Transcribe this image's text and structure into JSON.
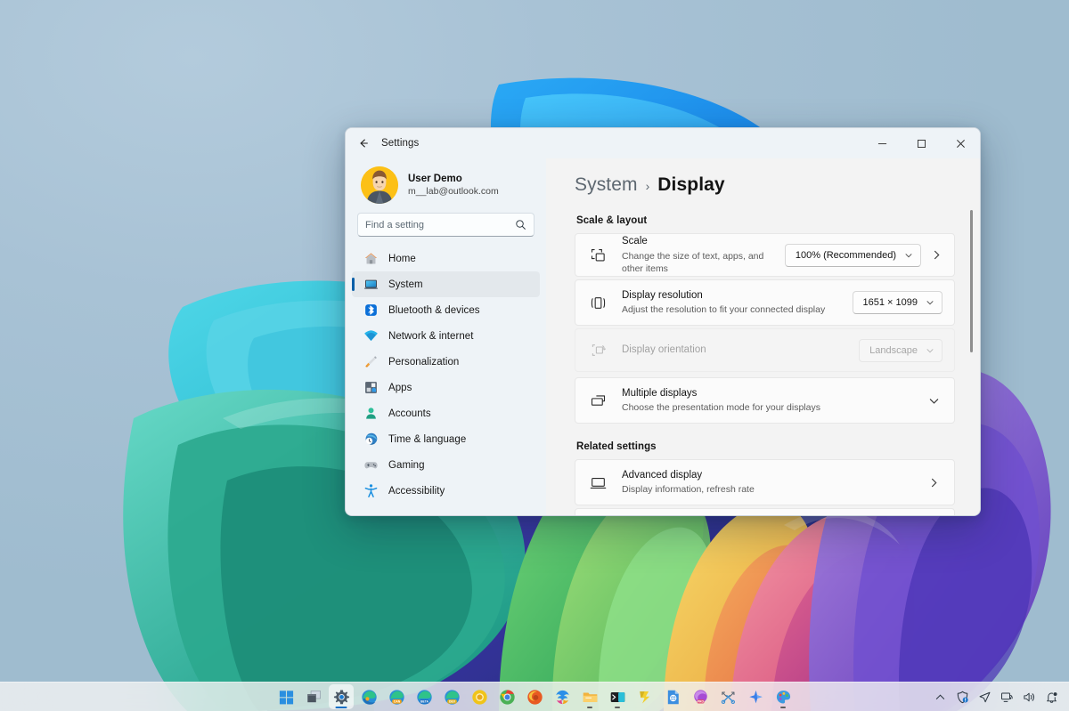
{
  "window": {
    "title": "Settings",
    "back_icon": "back-arrow-icon",
    "controls": {
      "minimize": "minimize-icon",
      "maximize": "maximize-icon",
      "close": "close-icon"
    }
  },
  "profile": {
    "name": "User Demo",
    "email": "m__lab@outlook.com",
    "avatar_icon": "user-avatar",
    "avatar_bg": "#fcc016"
  },
  "search": {
    "placeholder": "Find a setting",
    "value": "",
    "icon": "search-icon"
  },
  "sidebar": {
    "items": [
      {
        "label": "Home",
        "icon": "home-icon",
        "selected": false
      },
      {
        "label": "System",
        "icon": "system-icon",
        "selected": true
      },
      {
        "label": "Bluetooth & devices",
        "icon": "bluetooth-icon",
        "selected": false
      },
      {
        "label": "Network & internet",
        "icon": "network-icon",
        "selected": false
      },
      {
        "label": "Personalization",
        "icon": "brush-icon",
        "selected": false
      },
      {
        "label": "Apps",
        "icon": "apps-icon",
        "selected": false
      },
      {
        "label": "Accounts",
        "icon": "accounts-icon",
        "selected": false
      },
      {
        "label": "Time & language",
        "icon": "clock-globe-icon",
        "selected": false
      },
      {
        "label": "Gaming",
        "icon": "gamepad-icon",
        "selected": false
      },
      {
        "label": "Accessibility",
        "icon": "accessibility-icon",
        "selected": false
      }
    ]
  },
  "breadcrumb": {
    "parent": "System",
    "separator": "›",
    "current": "Display"
  },
  "main": {
    "section1_title": "Scale & layout",
    "section2_title": "Related settings",
    "cards": [
      {
        "title": "Scale",
        "subtitle": "Change the size of text, apps, and other items",
        "icon": "scale-icon",
        "combo_value": "100% (Recommended)",
        "has_chevron_right": true,
        "disabled": false
      },
      {
        "title": "Display resolution",
        "subtitle": "Adjust the resolution to fit your connected display",
        "icon": "resolution-icon",
        "combo_value": "1651 × 1099",
        "has_chevron_right": false,
        "disabled": false
      },
      {
        "title": "Display orientation",
        "subtitle": "",
        "icon": "orientation-icon",
        "combo_value": "Landscape",
        "has_chevron_right": false,
        "disabled": true
      },
      {
        "title": "Multiple displays",
        "subtitle": "Choose the presentation mode for your displays",
        "icon": "multiple-displays-icon",
        "combo_value": "",
        "has_chevron_down": true,
        "disabled": false
      }
    ],
    "related": [
      {
        "title": "Advanced display",
        "subtitle": "Display information, refresh rate",
        "icon": "advanced-display-icon",
        "has_chevron_right": true
      }
    ]
  },
  "taskbar": {
    "apps": [
      {
        "name": "start-button",
        "running": false,
        "active": false
      },
      {
        "name": "task-view-button",
        "running": false,
        "active": false
      },
      {
        "name": "settings-app",
        "running": true,
        "active": true
      },
      {
        "name": "edge-browser",
        "running": false,
        "active": false
      },
      {
        "name": "edge-canary-browser",
        "running": false,
        "active": false
      },
      {
        "name": "edge-beta-browser",
        "running": false,
        "active": false
      },
      {
        "name": "edge-dev-browser",
        "running": false,
        "active": false
      },
      {
        "name": "chrome-canary-browser",
        "running": false,
        "active": false
      },
      {
        "name": "chrome-browser",
        "running": false,
        "active": false
      },
      {
        "name": "firefox-browser",
        "running": false,
        "active": false
      },
      {
        "name": "copilot-app",
        "running": false,
        "active": false
      },
      {
        "name": "file-explorer",
        "running": true,
        "active": false
      },
      {
        "name": "terminal-app",
        "running": true,
        "active": false
      },
      {
        "name": "powershell-ise-app",
        "running": false,
        "active": false
      },
      {
        "name": "word-document-app",
        "running": false,
        "active": false
      },
      {
        "name": "pro-app",
        "running": false,
        "active": false
      },
      {
        "name": "snipping-tool-app",
        "running": false,
        "active": false
      },
      {
        "name": "copilot-sparkle-app",
        "running": false,
        "active": false
      },
      {
        "name": "paint-app",
        "running": true,
        "active": false
      }
    ],
    "tray": [
      {
        "name": "show-hidden-icons-chevron"
      },
      {
        "name": "security-shield-icon"
      },
      {
        "name": "send-feedback-icon"
      },
      {
        "name": "network-tray-icon"
      },
      {
        "name": "volume-tray-icon"
      },
      {
        "name": "notification-bell-icon"
      }
    ]
  },
  "colors": {
    "accent": "#0a5fa8",
    "window_bg": "#f3f3f3",
    "sidebar_bg": "#eef3f7",
    "card_bg": "#fbfbfb",
    "close_hover": "#c42b1c"
  }
}
